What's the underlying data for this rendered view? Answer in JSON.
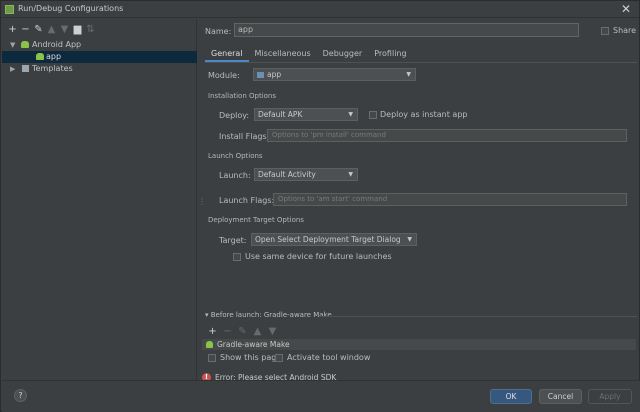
{
  "window": {
    "title": "Run/Debug Configurations",
    "close_glyph": "✕"
  },
  "left_toolbar": {
    "add": "+",
    "remove": "−",
    "edit": "✎",
    "up": "▲",
    "down": "▼",
    "folder": "▆",
    "sort": "⇅"
  },
  "tree": {
    "items": [
      {
        "label": "Android App",
        "arrow": "▼"
      },
      {
        "label": "app"
      },
      {
        "label": "Templates",
        "arrow": "▶"
      }
    ]
  },
  "config": {
    "name_label": "Name:",
    "name_value": "app",
    "share_label": "Share",
    "tabs": [
      "General",
      "Miscellaneous",
      "Debugger",
      "Profiling"
    ],
    "module_label": "Module:",
    "module_value": "app",
    "installation_options": "Installation Options",
    "deploy_label": "Deploy:",
    "deploy_value": "Default APK",
    "instant_label": "Deploy as instant app",
    "install_flags_label": "Install Flags:",
    "install_flags_placeholder": "Options to 'pm install' command",
    "launch_options": "Launch Options",
    "launch_label": "Launch:",
    "launch_value": "Default Activity",
    "launch_flags_label": "Launch Flags:",
    "launch_flags_placeholder": "Options to 'am start' command",
    "deployment_target_options": "Deployment Target Options",
    "target_label": "Target:",
    "target_value": "Open Select Deployment Target Dialog",
    "same_device_label": "Use same device for future launches",
    "before_launch": "Before launch: Gradle-aware Make",
    "bl_add": "+",
    "bl_remove": "−",
    "bl_edit": "✎",
    "bl_up": "▲",
    "bl_down": "▼",
    "task": "Gradle-aware Make",
    "show_page_label": "Show this page",
    "activate_tool_label": "Activate tool window",
    "error_text": "Error: Please select Android SDK"
  },
  "buttons": {
    "help": "?",
    "ok": "OK",
    "cancel": "Cancel",
    "apply": "Apply"
  },
  "colors": {
    "background": "#3c3f41",
    "selection": "#0d293e",
    "accent": "#4a88c7",
    "error": "#c75450",
    "android": "#8bc34a"
  }
}
